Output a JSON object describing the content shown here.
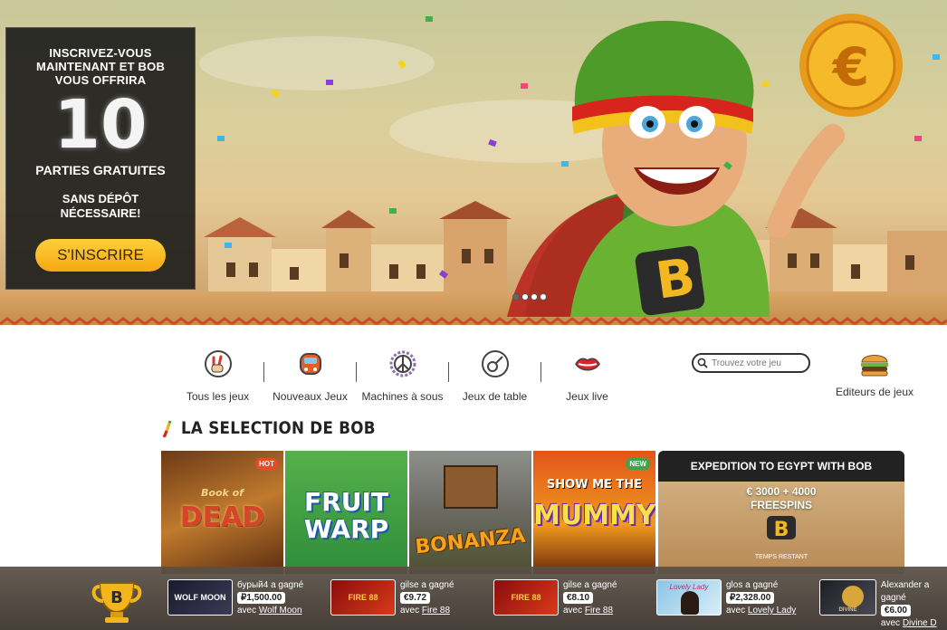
{
  "hero": {
    "promo": {
      "line1": "INSCRIVEZ-VOUS",
      "line2": "MAINTENANT ET BOB",
      "line3": "VOUS OFFRIRA",
      "number": "10",
      "free_spins": "PARTIES GRATUITES",
      "line4": "SANS DÉPÔT",
      "line5": "NÉCESSAIRE!",
      "cta": "S'INSCRIRE"
    },
    "coin_symbol": "€",
    "slides": 4,
    "active_slide": 1
  },
  "nav": {
    "items": [
      {
        "label": "Tous les jeux",
        "icon": "peace-hand-icon"
      },
      {
        "label": "Nouveaux Jeux",
        "icon": "van-icon"
      },
      {
        "label": "Machines à sous",
        "icon": "peace-sign-icon"
      },
      {
        "label": "Jeux de table",
        "icon": "guitar-icon"
      },
      {
        "label": "Jeux live",
        "icon": "lips-icon"
      }
    ],
    "search_placeholder": "Trouvez votre jeu",
    "editors_label": "Editeurs de jeux"
  },
  "section": {
    "title": "LA SELECTION DE BOB"
  },
  "tiles": [
    {
      "name_line1": "Book of",
      "name_line2": "DEAD",
      "badge": "HOT",
      "badge_color": "#e34b2b"
    },
    {
      "name_line1": "FRUIT",
      "name_line2": "WARP",
      "badge": "",
      "badge_color": ""
    },
    {
      "name_line1": "BONANZA",
      "name_line2": "",
      "badge": "",
      "badge_color": ""
    },
    {
      "name_line1": "SHOW ME THE",
      "name_line2": "MUMMY",
      "badge": "NEW",
      "badge_color": "#3fa34d"
    }
  ],
  "expedition": {
    "title": "EXPEDITION TO EGYPT WITH BOB",
    "amount": "€ 3000 + 4000",
    "freespins": "FREESPINS",
    "timer_label": "TEMPS RESTANT"
  },
  "ticker": [
    {
      "user": "бурый4",
      "verb": "a gagné",
      "amount": "₽1,500.00",
      "prefix": "avec",
      "game": "Wolf Moon",
      "thumb_text": "WOLF MOON"
    },
    {
      "user": "gilse",
      "verb": "a gagné",
      "amount": "€9.72",
      "prefix": "avec",
      "game": "Fire 88",
      "thumb_text": "FIRE 88"
    },
    {
      "user": "gilse",
      "verb": "a gagné",
      "amount": "€8.10",
      "prefix": "avec",
      "game": "Fire 88",
      "thumb_text": "FIRE 88"
    },
    {
      "user": "glos",
      "verb": "a gagné",
      "amount": "₽2,328.00",
      "prefix": "avec",
      "game": "Lovely Lady",
      "thumb_text": "Lovely Lady"
    },
    {
      "user": "Alexander",
      "verb": "a gagné",
      "amount": "€6.00",
      "prefix": "avec",
      "game": "Divine D",
      "thumb_text": "DIVINE"
    }
  ]
}
